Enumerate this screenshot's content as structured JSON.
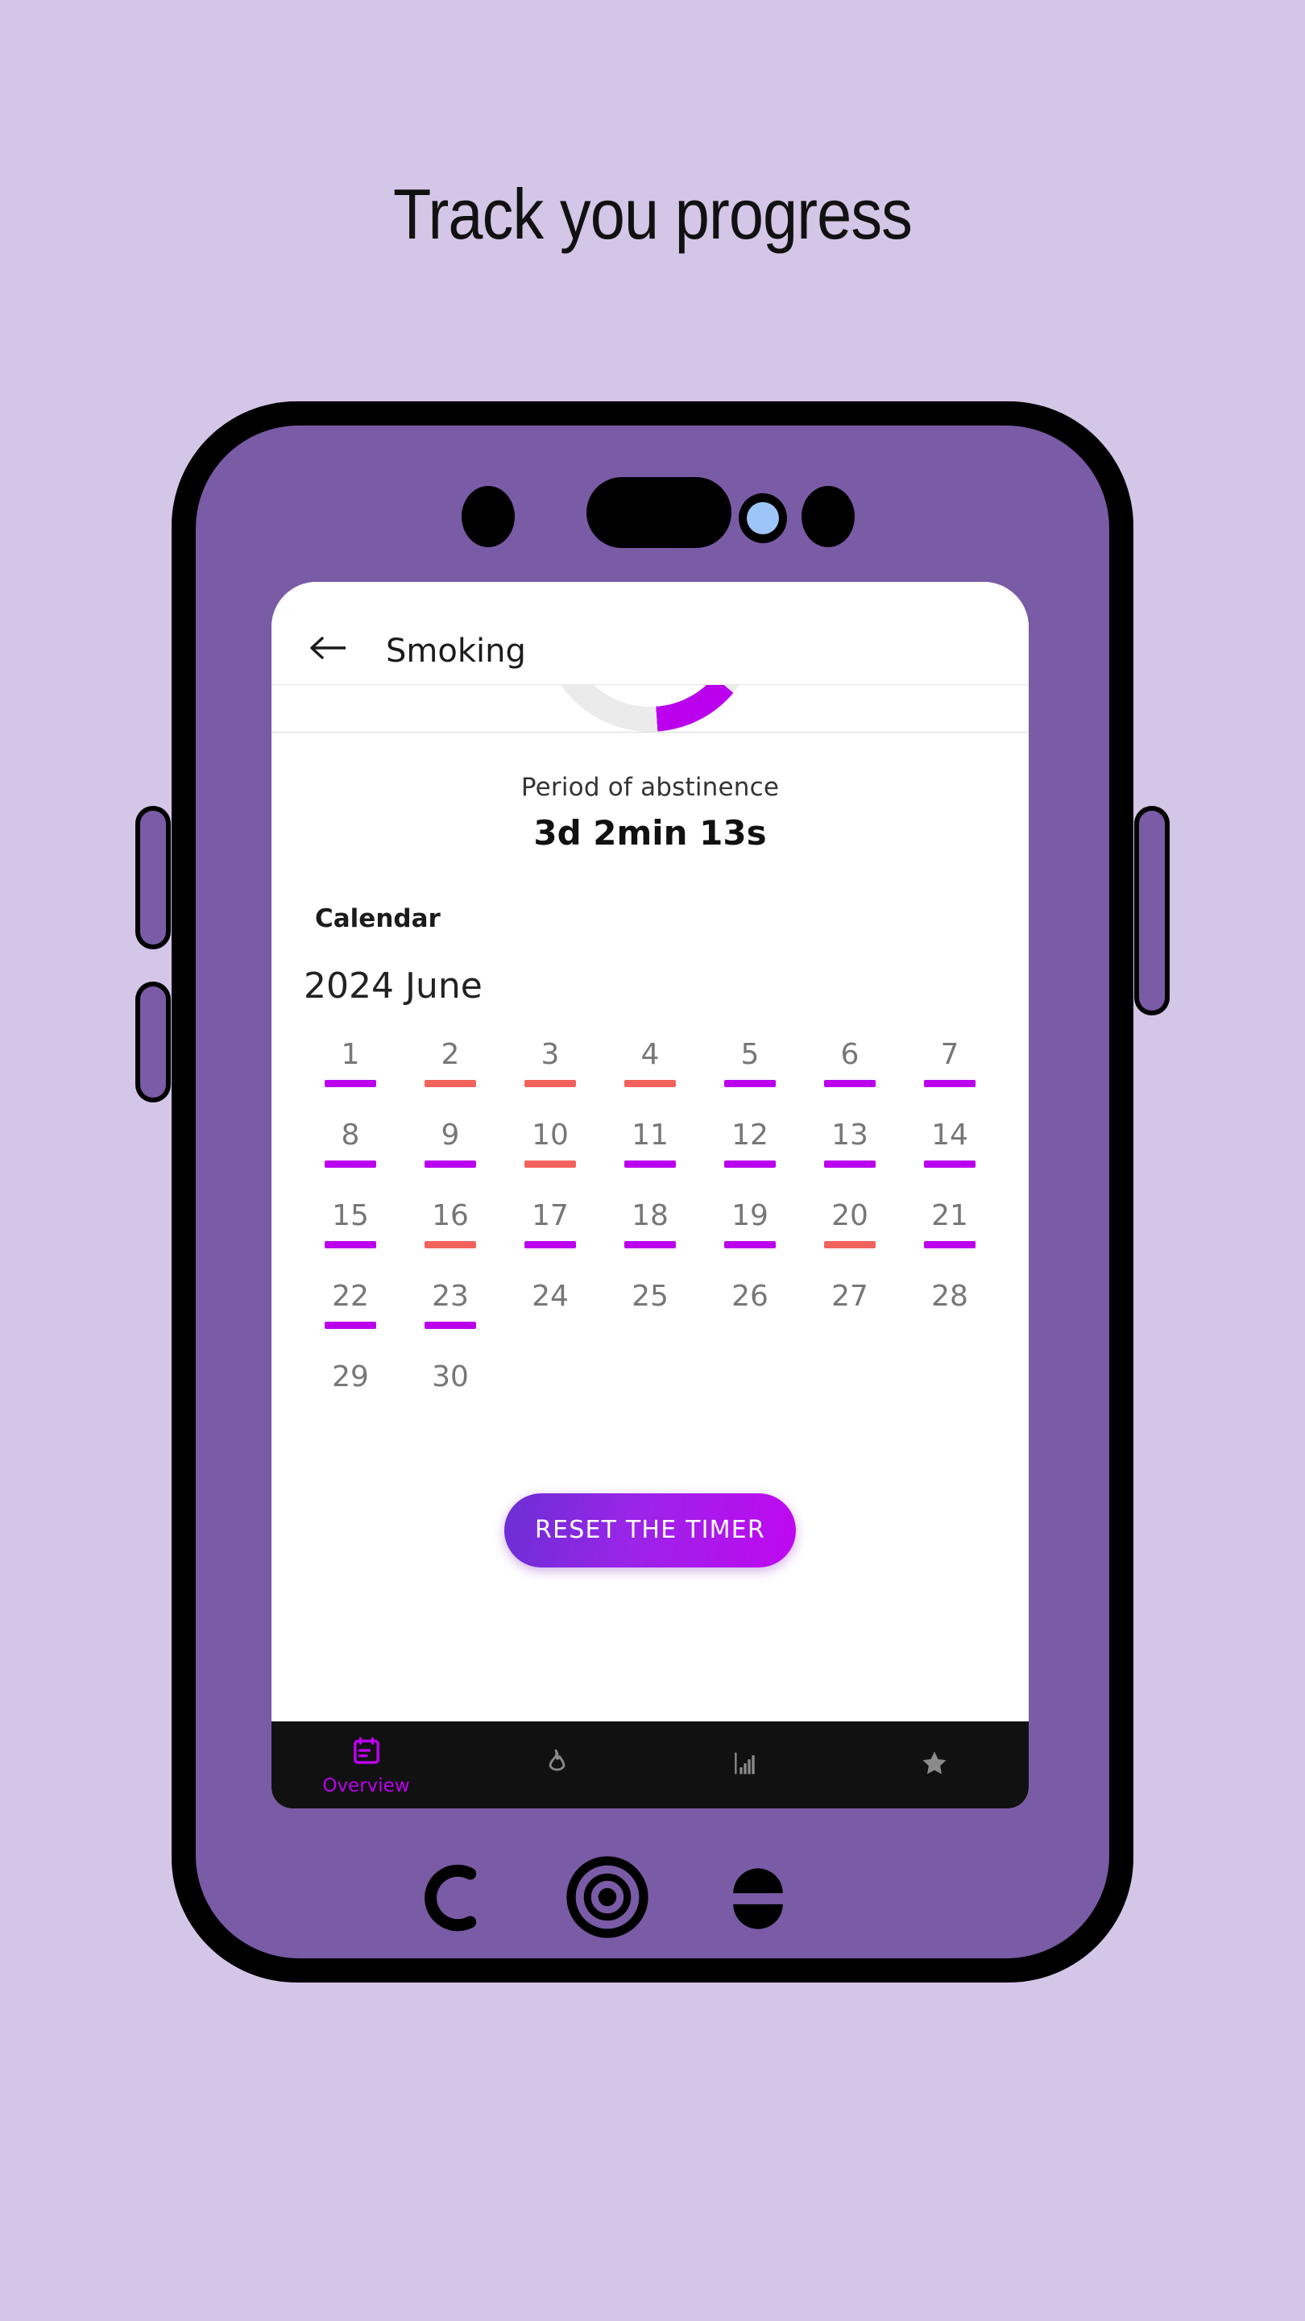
{
  "page": {
    "headline": "Track you progress",
    "background_color": "#d4c6e7",
    "phone_body_color": "#7a5ba6"
  },
  "appbar": {
    "back_icon": "arrow-left-icon",
    "title": "Smoking"
  },
  "progress_ring": {
    "track_color": "#ebebeb",
    "progress_color": "#bb00ee"
  },
  "abstinence": {
    "label": "Period of abstinence",
    "value": "3d 2min 13s"
  },
  "calendar": {
    "section_label": "Calendar",
    "month": "2024 June",
    "good_color": "#bb00ee",
    "bad_color": "#f2625c",
    "days": [
      {
        "num": "1",
        "state": "good"
      },
      {
        "num": "2",
        "state": "bad"
      },
      {
        "num": "3",
        "state": "bad"
      },
      {
        "num": "4",
        "state": "bad"
      },
      {
        "num": "5",
        "state": "good"
      },
      {
        "num": "6",
        "state": "good"
      },
      {
        "num": "7",
        "state": "good"
      },
      {
        "num": "8",
        "state": "good"
      },
      {
        "num": "9",
        "state": "good"
      },
      {
        "num": "10",
        "state": "bad"
      },
      {
        "num": "11",
        "state": "good"
      },
      {
        "num": "12",
        "state": "good"
      },
      {
        "num": "13",
        "state": "good"
      },
      {
        "num": "14",
        "state": "good"
      },
      {
        "num": "15",
        "state": "good"
      },
      {
        "num": "16",
        "state": "bad"
      },
      {
        "num": "17",
        "state": "good"
      },
      {
        "num": "18",
        "state": "good"
      },
      {
        "num": "19",
        "state": "good"
      },
      {
        "num": "20",
        "state": "bad"
      },
      {
        "num": "21",
        "state": "good"
      },
      {
        "num": "22",
        "state": "good"
      },
      {
        "num": "23",
        "state": "good"
      },
      {
        "num": "24",
        "state": "none"
      },
      {
        "num": "25",
        "state": "none"
      },
      {
        "num": "26",
        "state": "none"
      },
      {
        "num": "27",
        "state": "none"
      },
      {
        "num": "28",
        "state": "none"
      },
      {
        "num": "29",
        "state": "none"
      },
      {
        "num": "30",
        "state": "none"
      }
    ]
  },
  "reset": {
    "label": "RESET THE TIMER"
  },
  "bottom_nav": {
    "active_color": "#bb00ee",
    "inactive_color": "#8a8a8a",
    "items": [
      {
        "icon": "calendar-icon",
        "label": "Overview",
        "active": true
      },
      {
        "icon": "flame-icon",
        "label": "",
        "active": false
      },
      {
        "icon": "bar-chart-icon",
        "label": "",
        "active": false
      },
      {
        "icon": "star-icon",
        "label": "",
        "active": false
      }
    ]
  },
  "hardware": {
    "back_button": "back-c-icon",
    "home_button": "home-circle-icon",
    "menu_button": "menu-split-icon"
  }
}
